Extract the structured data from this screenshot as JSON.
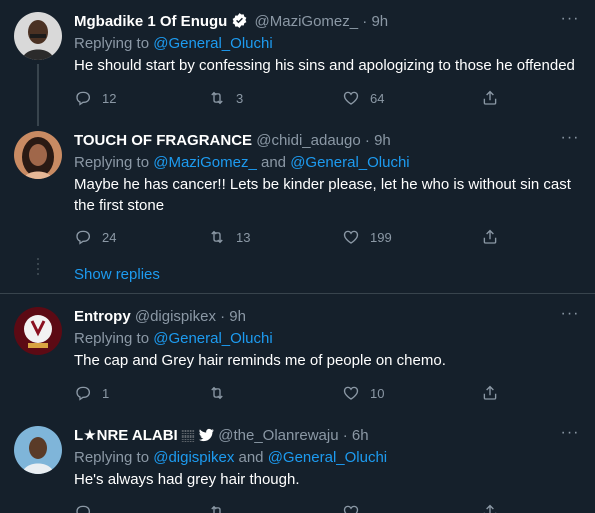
{
  "tweets": [
    {
      "name": "Mgbadike 1 Of Enugu",
      "handle": "@MaziGomez_",
      "separator": "·",
      "time": "9h",
      "replying_prefix": "Replying to ",
      "mention_1": "@General_Oluchi",
      "text": "He should start by confessing his sins and apologizing to those he offended",
      "replies": "12",
      "retweets": "3",
      "likes": "64"
    },
    {
      "name": "TOUCH OF FRAGRANCE",
      "handle": "@chidi_adaugo",
      "separator": "·",
      "time": "9h",
      "replying_prefix": "Replying to ",
      "mention_1": "@MaziGomez_",
      "conjunction": " and ",
      "mention_2": "@General_Oluchi",
      "text": "Maybe he has cancer!! Lets be kinder please, let he who is without sin cast the first stone",
      "replies": "24",
      "retweets": "13",
      "likes": "199"
    },
    {
      "name": "Entropy",
      "handle": "@digispikex",
      "separator": "·",
      "time": "9h",
      "replying_prefix": "Replying to ",
      "mention_1": "@General_Oluchi",
      "text": "The cap and Grey hair reminds me of people on chemo.",
      "replies": "1",
      "retweets": "",
      "likes": "10"
    },
    {
      "name": "L★NRE ALABI �much",
      "name_main": "L★NRE ALABI",
      "name_emoji": "🏽",
      "handle": "@the_Olanrewaju",
      "separator": "·",
      "time": "6h",
      "replying_prefix": "Replying to ",
      "mention_1": "@digispikex",
      "conjunction": " and ",
      "mention_2": "@General_Oluchi",
      "text": "He's always had grey hair though."
    }
  ],
  "show_replies_label": "Show replies",
  "more_label": "···",
  "icons": {
    "reply": "reply-icon",
    "retweet": "retweet-icon",
    "like": "heart-icon",
    "share": "share-icon",
    "verified": "verified-badge-icon",
    "twitter_bird": "twitter-bird-icon"
  },
  "colors": {
    "background": "#15202b",
    "link": "#1d9bf0",
    "muted": "#8b98a5",
    "border": "#38444d"
  }
}
